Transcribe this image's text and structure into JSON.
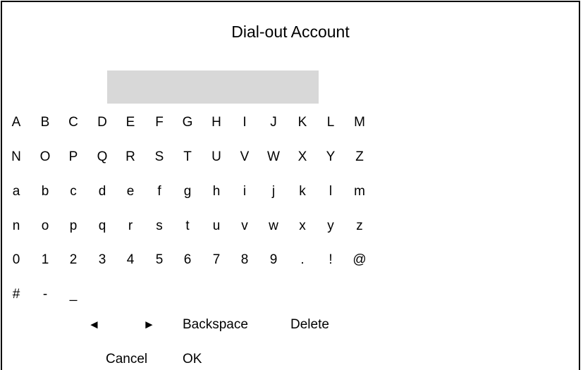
{
  "dialog": {
    "title": "Dial-out Account",
    "account_value": ""
  },
  "keyboard": {
    "rows": [
      [
        "A",
        "B",
        "C",
        "D",
        "E",
        "F",
        "G",
        "H",
        "I",
        "J",
        "K",
        "L",
        "M"
      ],
      [
        "N",
        "O",
        "P",
        "Q",
        "R",
        "S",
        "T",
        "U",
        "V",
        "W",
        "X",
        "Y",
        "Z"
      ],
      [
        "a",
        "b",
        "c",
        "d",
        "e",
        "f",
        "g",
        "h",
        "i",
        "j",
        "k",
        "l",
        "m"
      ],
      [
        "n",
        "o",
        "p",
        "q",
        "r",
        "s",
        "t",
        "u",
        "v",
        "w",
        "x",
        "y",
        "z"
      ],
      [
        "0",
        "1",
        "2",
        "3",
        "4",
        "5",
        "6",
        "7",
        "8",
        "9",
        ".",
        "!",
        "@"
      ],
      [
        "#",
        "-",
        "_"
      ]
    ]
  },
  "controls": {
    "left_arrow": "◄",
    "right_arrow": "►",
    "backspace": "Backspace",
    "delete": "Delete",
    "cancel": "Cancel",
    "ok": "OK"
  }
}
